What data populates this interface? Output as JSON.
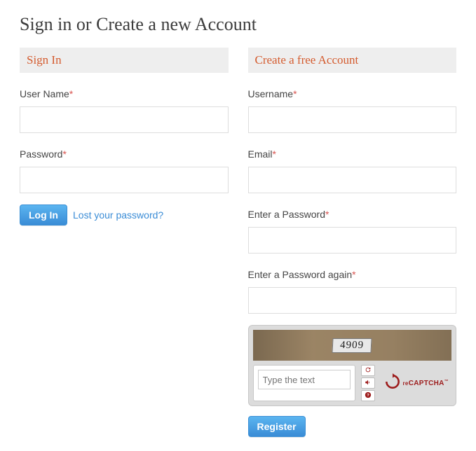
{
  "page": {
    "title": "Sign in or Create a new Account"
  },
  "signin": {
    "header": "Sign In",
    "username_label": "User Name",
    "password_label": "Password",
    "login_btn": "Log In",
    "lost_password": "Lost your password?"
  },
  "register": {
    "header": "Create a free Account",
    "username_label": "Username",
    "email_label": "Email",
    "password_label": "Enter a Password",
    "password2_label": "Enter a Password again",
    "register_btn": "Register"
  },
  "captcha": {
    "challenge_text": "4909",
    "placeholder": "Type the text",
    "brand_re": "re",
    "brand_main": "CAPTCHA",
    "brand_tm": "™"
  },
  "required_marker": "*"
}
